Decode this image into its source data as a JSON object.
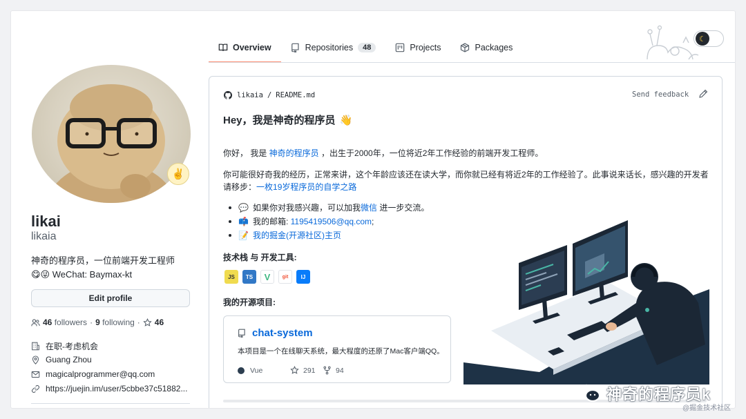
{
  "tabs": [
    {
      "label": "Overview",
      "icon": "book-icon",
      "active": true
    },
    {
      "label": "Repositories",
      "icon": "repo-icon",
      "count": "48"
    },
    {
      "label": "Projects",
      "icon": "project-icon"
    },
    {
      "label": "Packages",
      "icon": "package-icon"
    }
  ],
  "profile": {
    "name": "likai",
    "login": "likaia",
    "bio_line1": "神奇的程序员，一位前端开发工程师",
    "bio_line2": "😋😜 WeChat: Baymax-kt",
    "edit_label": "Edit profile",
    "followers_count": "46",
    "followers_label": "followers",
    "following_count": "9",
    "following_label": "following",
    "stars_count": "46",
    "company": "在职-考虑机会",
    "location": "Guang Zhou",
    "email": "magicalprogrammer@qq.com",
    "website": "https://juejin.im/user/5cbbe37c51882...",
    "status_emoji": "✌️"
  },
  "readme": {
    "user": "likaia",
    "separator": "/",
    "file": "README.md",
    "feedback_label": "Send feedback",
    "title": "Hey，我是神奇的程序员",
    "title_emoji": "👋",
    "para1_a": "你好，  我是 ",
    "para1_link": "神奇的程序员",
    "para1_b": " ，出生于2000年，一位将近2年工作经验的前端开发工程师。",
    "para2_a": "你可能很好奇我的经历，正常来讲，这个年龄应该还在读大学，而你就已经有将近2年的工作经验了。此事说来话长，感兴趣的开发者请移步：",
    "para2_link": "一枚19岁程序员的自学之路",
    "bullet1_emoji": "💬",
    "bullet1_a": "如果你对我感兴趣，可以加我",
    "bullet1_link": "微信",
    "bullet1_b": " 进一步交流。",
    "bullet2_emoji": "📫",
    "bullet2_a": "我的邮箱: ",
    "bullet2_link": "1195419506@qq.com",
    "bullet2_b": ";",
    "bullet3_emoji": "📝",
    "bullet3_link": "我的掘金(开源社区)主页",
    "tech_heading": "技术栈 与 开发工具:",
    "badges": [
      "JS",
      "TS",
      "V",
      "git",
      "IJ"
    ],
    "projects_heading": "我的开源项目:"
  },
  "repo_card": {
    "name": "chat-system",
    "description": "本项目是一个在线聊天系统，最大程度的还原了Mac客户端QQ。",
    "language": "Vue",
    "stars": "291",
    "forks": "94"
  },
  "watermark": {
    "text": "神奇的程序员k",
    "source": "@掘金技术社区"
  },
  "colors": {
    "accent": "#fd8c73",
    "link": "#0969da",
    "vue_dot": "#2c3e50"
  }
}
